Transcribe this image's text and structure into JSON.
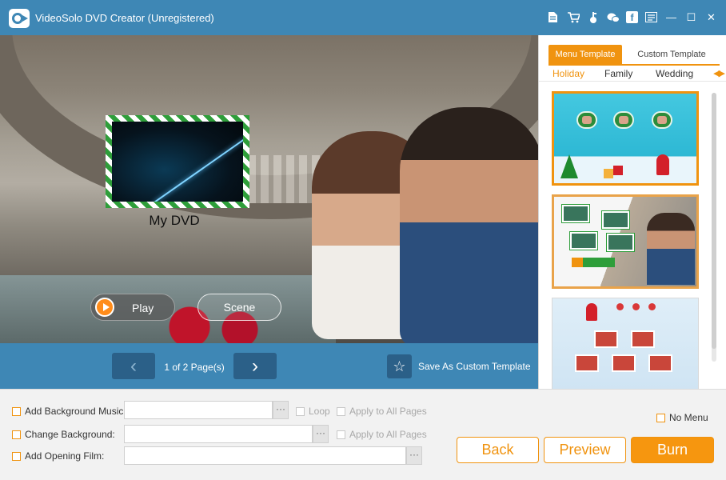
{
  "window": {
    "title": "VideoSolo DVD Creator (Unregistered)",
    "controls": [
      "file-icon",
      "cart-icon",
      "key-icon",
      "chat-icon",
      "facebook-icon",
      "menu-icon",
      "minimize-icon",
      "maximize-icon",
      "close-icon"
    ],
    "facebook_glyph": "f",
    "minimize_glyph": "—",
    "maximize_glyph": "☐",
    "close_glyph": "✕",
    "accent_color": "#3e87b5"
  },
  "preview": {
    "dvd_title": "My DVD",
    "play_label": "Play",
    "scene_label": "Scene"
  },
  "pager": {
    "prev_glyph": "‹",
    "next_glyph": "›",
    "page_text": "1 of 2 Page(s)",
    "save_template_label": "Save As Custom Template",
    "star_glyph": "☆"
  },
  "templates": {
    "tabs": [
      "Menu Template",
      "Custom Template"
    ],
    "active_tab": "Menu Template",
    "categories": [
      "Holiday",
      "Family",
      "Wedding"
    ],
    "active_category": "Holiday",
    "scroll_glyph": "◀▶",
    "items": [
      {
        "name": "holiday-christmas-green",
        "state": "selected"
      },
      {
        "name": "holiday-christmas-photo",
        "state": "highlighted"
      },
      {
        "name": "holiday-christmas-light",
        "state": "normal"
      }
    ],
    "accent_color": "#f0930f"
  },
  "bottom": {
    "bg_music_label": "Add Background Music:",
    "bg_music_value": "",
    "change_bg_label": "Change Background:",
    "change_bg_value": "",
    "opening_film_label": "Add Opening Film:",
    "opening_film_value": "",
    "browse_label": "···",
    "loop_label": "Loop",
    "apply_all_label": "Apply to All Pages",
    "no_menu_label": "No Menu",
    "back_label": "Back",
    "preview_label": "Preview",
    "burn_label": "Burn"
  }
}
